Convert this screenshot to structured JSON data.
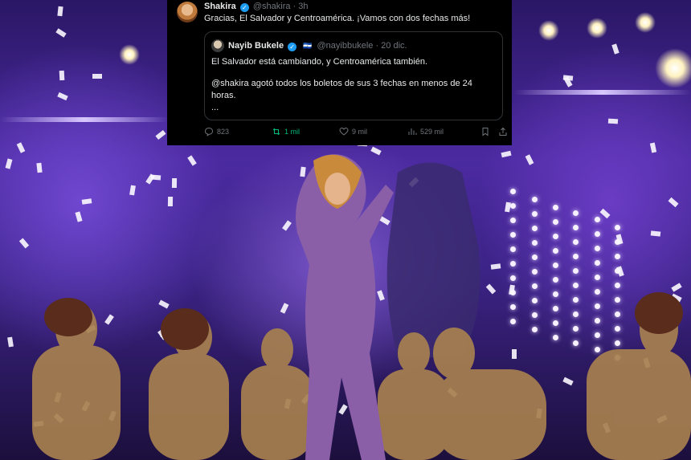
{
  "tweet": {
    "author_name": "Shakira",
    "author_handle": "@shakira",
    "time": "· 3h",
    "text": "Gracias, El Salvador y Centroamérica. ¡Vamos con dos fechas más!",
    "quoted": {
      "author_name": "Nayib Bukele",
      "author_handle": "@nayibbukele",
      "time": "· 20 dic.",
      "line1": "El Salvador está cambiando, y Centroamérica también.",
      "line2": "@shakira agotó todos los boletos de sus 3 fechas en menos de 24",
      "line3": "horas.",
      "line4": "..."
    },
    "metrics": {
      "replies": "823",
      "reposts": "1 mil",
      "likes": "9 mil",
      "views": "529 mil"
    }
  },
  "icons": {
    "verified": "verified-badge-icon",
    "reply": "reply-icon",
    "repost": "repost-icon",
    "like": "heart-icon",
    "views": "views-icon",
    "bookmark": "bookmark-icon",
    "share": "share-icon"
  },
  "colors": {
    "accent_blue": "#1d9bf0",
    "repost_green": "#00ba7c",
    "muted": "#71767b",
    "stage_purple": "#4b2aa0"
  }
}
